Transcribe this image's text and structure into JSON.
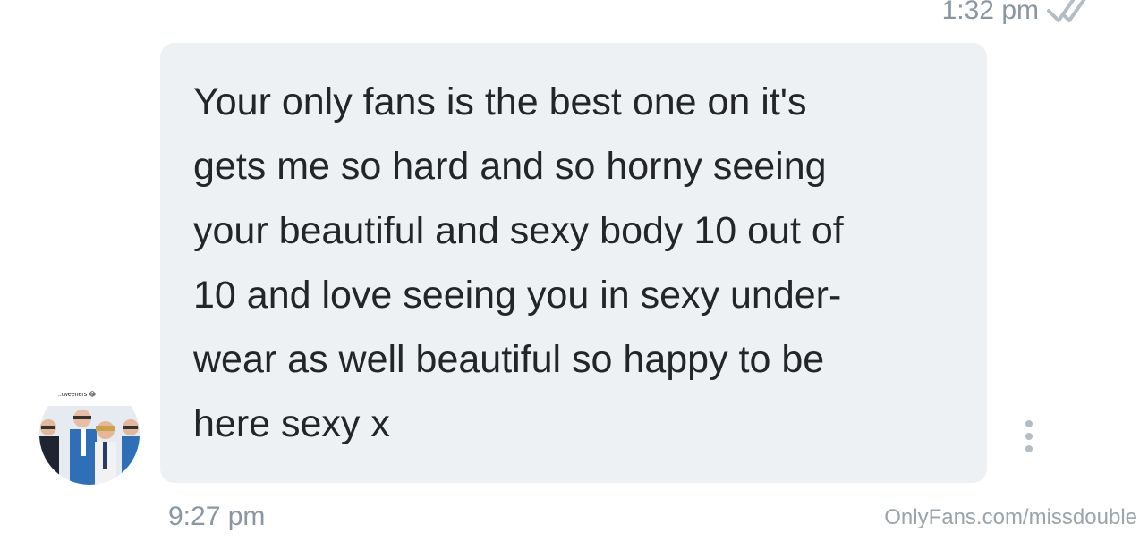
{
  "header": {
    "sent_time": "1:32 pm",
    "read_status_icon": "double-check-icon"
  },
  "message": {
    "lines": [
      "Your only fans is the best one on it's",
      "gets me so hard and so horny seeing",
      "your beautiful and sexy body 10 out of",
      "10 and love seeing you in sexy under-",
      "wear as well beautiful so happy to be",
      "here sexy x"
    ],
    "time": "9:27 pm",
    "more_icon": "more-vertical-icon"
  },
  "avatar": {
    "caption": "...tweeners 😂"
  },
  "watermark": {
    "text": "OnlyFans.com/missdouble"
  },
  "colors": {
    "bubble_bg": "#eef1f3",
    "message_text": "#242529",
    "meta_text": "#8a96a3",
    "watermark_text": "#9aa4ad"
  }
}
